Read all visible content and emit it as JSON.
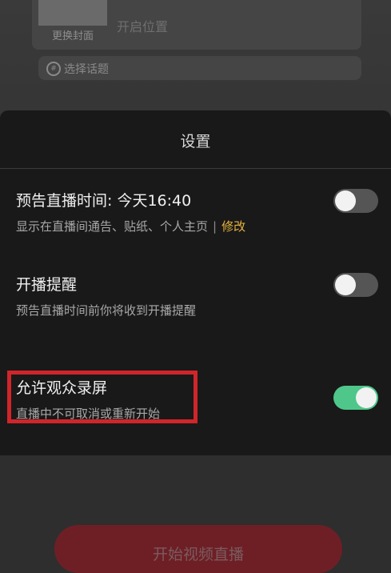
{
  "background": {
    "cover_label": "更换封面",
    "location_text": "开启位置",
    "topic_placeholder": "选择话题",
    "start_button": "开始视频直播"
  },
  "settings": {
    "title": "设置",
    "items": [
      {
        "title": "预告直播时间: 今天16:40",
        "subtitle": "显示在直播间通告、贴纸、个人主页",
        "separator": "|",
        "action": "修改",
        "toggle_on": false
      },
      {
        "title": "开播提醒",
        "subtitle": "预告直播时间前你将收到开播提醒",
        "toggle_on": false
      },
      {
        "title": "允许观众录屏",
        "subtitle": "直播中不可取消或重新开始",
        "toggle_on": true
      }
    ]
  },
  "colors": {
    "toggle_on": "#4fc78a",
    "toggle_off": "#555555",
    "edit_link": "#e7b23b",
    "highlight": "#d0252a"
  }
}
